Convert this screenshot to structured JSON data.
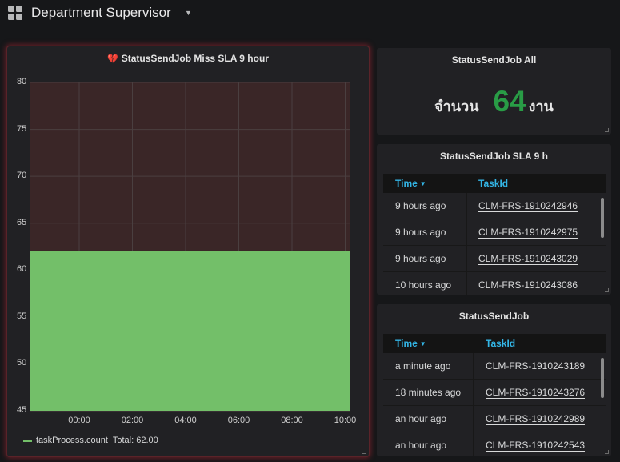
{
  "header": {
    "title": "Department Supervisor",
    "caret_icon": "caret-down-icon",
    "grid_icon": "dashboard-grid-icon"
  },
  "graph_panel": {
    "title": "StatusSendJob Miss SLA 9 hour",
    "title_icon": "broken-heart-icon",
    "legend": {
      "series": "taskProcess.count",
      "total": "Total: 62.00"
    }
  },
  "chart_data": {
    "type": "area",
    "x": [
      "00:00",
      "02:00",
      "04:00",
      "06:00",
      "08:00",
      "10:00"
    ],
    "series": [
      {
        "name": "taskProcess.count",
        "values": [
          62,
          62,
          62,
          62,
          62,
          62
        ]
      }
    ],
    "ylim": [
      45,
      80
    ],
    "yticks": [
      "80",
      "75",
      "70",
      "65",
      "60",
      "55",
      "50",
      "45"
    ],
    "threshold": 62,
    "grid": true,
    "legend_placement": "bottom-left",
    "colors": {
      "series": "#73bf69",
      "critical_area": "#3a2627"
    }
  },
  "stat_panel": {
    "title": "StatusSendJob All",
    "prefix": "จำนวน",
    "value": "64",
    "suffix": "งาน",
    "value_color": "#299c46"
  },
  "sla_table": {
    "title": "StatusSendJob SLA 9 h",
    "columns": [
      "Time",
      "TaskId"
    ],
    "rows": [
      {
        "time": "9 hours ago",
        "task": "CLM-FRS-1910242946"
      },
      {
        "time": "9 hours ago",
        "task": "CLM-FRS-1910242975"
      },
      {
        "time": "9 hours ago",
        "task": "CLM-FRS-1910243029"
      },
      {
        "time": "10 hours ago",
        "task": "CLM-FRS-1910243086"
      }
    ]
  },
  "job_table": {
    "title": "StatusSendJob",
    "columns": [
      "Time",
      "TaskId"
    ],
    "rows": [
      {
        "time": "a minute ago",
        "task": "CLM-FRS-1910243189"
      },
      {
        "time": "18 minutes ago",
        "task": "CLM-FRS-1910243276"
      },
      {
        "time": "an hour ago",
        "task": "CLM-FRS-1910242989"
      },
      {
        "time": "an hour ago",
        "task": "CLM-FRS-1910242543"
      }
    ]
  }
}
